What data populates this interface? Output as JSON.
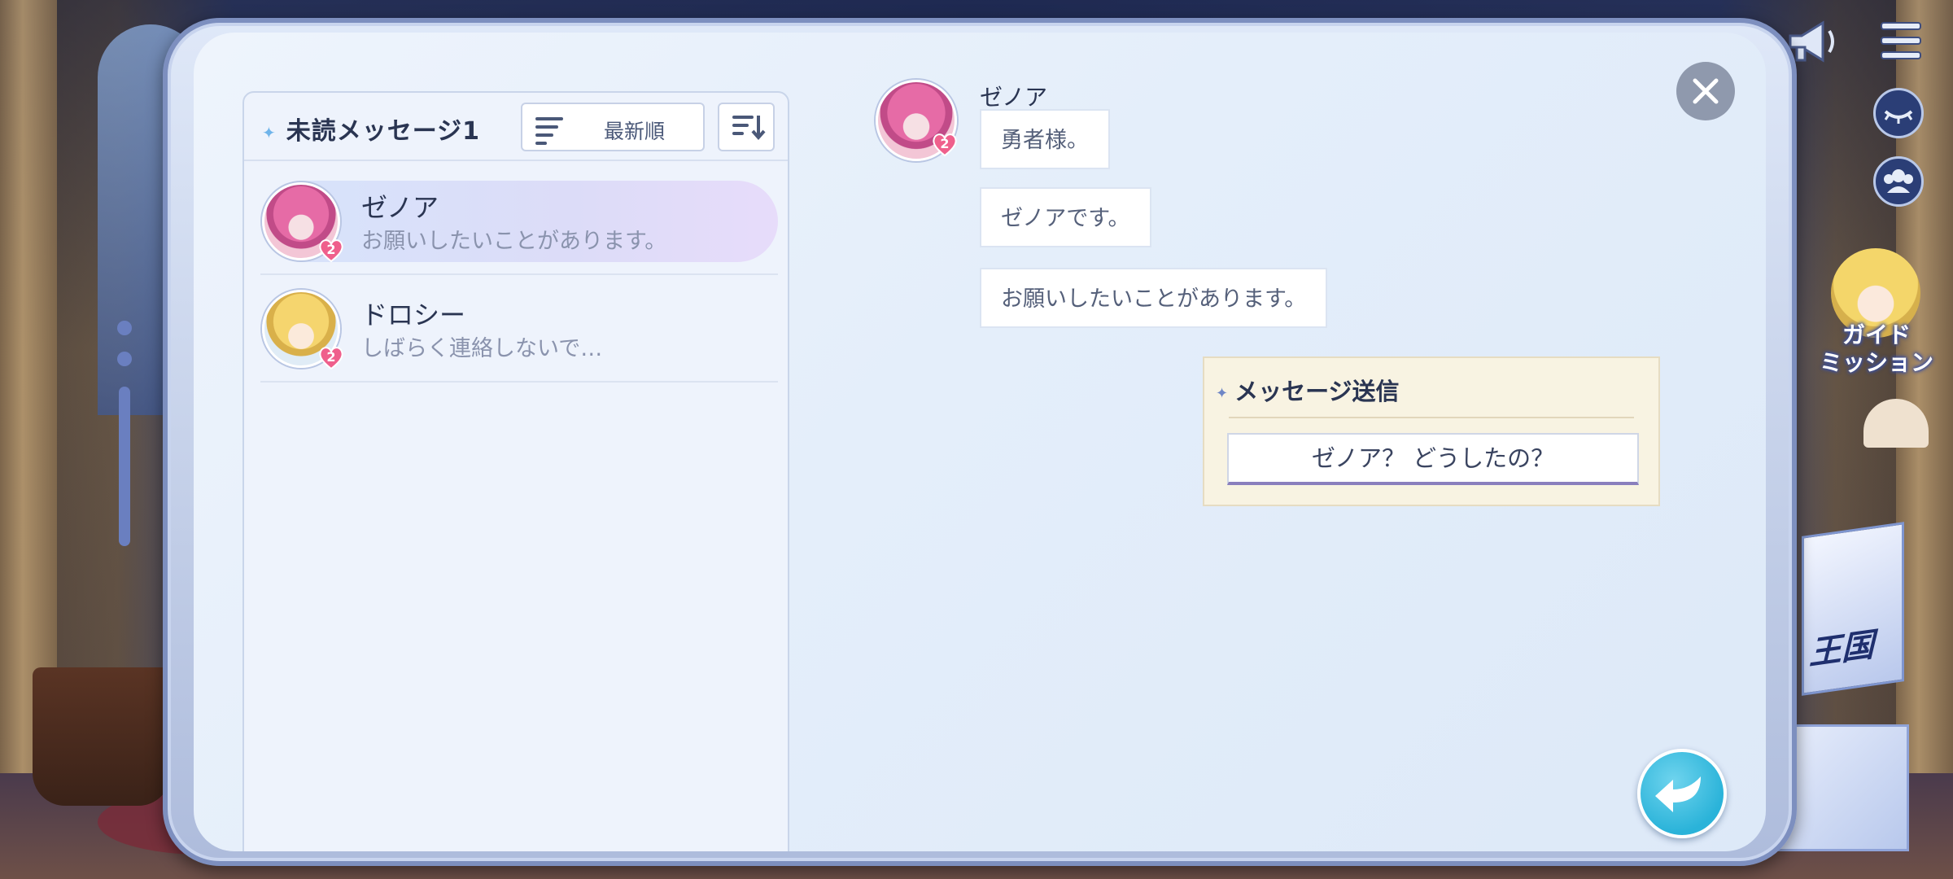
{
  "list": {
    "unread_title": "未読メッセージ1",
    "sort_label": "最新順",
    "contacts": [
      {
        "name": "ゼノア",
        "preview": "お願いしたいことがあります。",
        "badge": "2"
      },
      {
        "name": "ドロシー",
        "preview": "しばらく連絡しないで…",
        "badge": "2"
      }
    ]
  },
  "chat": {
    "sender_name": "ゼノア",
    "badge": "2",
    "messages": [
      "勇者様。",
      "ゼノアです。",
      "お願いしたいことがあります。"
    ],
    "reply": {
      "title": "メッセージ送信",
      "option": "ゼノア？ どうしたの？"
    }
  },
  "hud": {
    "guide_label_line1": "ガイド",
    "guide_label_line2": "ミッション",
    "kingdom_label": "王国"
  },
  "icons": {
    "close": "close-icon",
    "back": "reply-arrow-icon",
    "announcement": "megaphone-icon",
    "menu": "hamburger-menu-icon",
    "hide_ui": "closed-eye-icon",
    "friends": "group-icon",
    "sort": "sort-lines-icon",
    "order": "sort-descending-icon"
  },
  "colors": {
    "accent_blue": "#2ab3d9",
    "heart_badge": "#ef5f8c",
    "text_dark": "#2a3552"
  }
}
